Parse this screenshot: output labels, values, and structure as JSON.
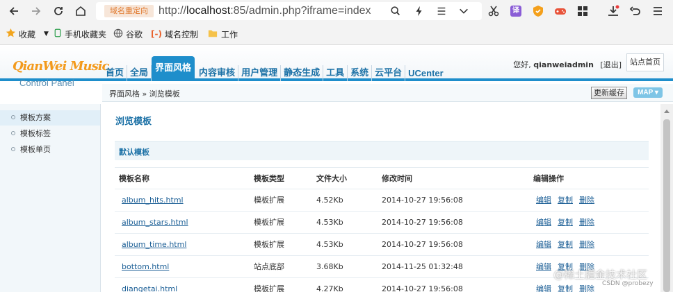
{
  "browser": {
    "redirect_badge": "域名重定向",
    "url_prefix": "http://",
    "url_host": "localhost",
    "url_rest": ":85/admin.php?iframe=index",
    "ext_badge": "译",
    "bookmarks": [
      {
        "label": "收藏",
        "icon": "star-icon"
      },
      {
        "label": "手机收藏夹",
        "icon": "phone-icon"
      },
      {
        "label": "谷歌",
        "icon": "globe-icon"
      },
      {
        "label": "域名控制",
        "icon": "bracket-icon"
      },
      {
        "label": "工作",
        "icon": "folder-icon"
      }
    ]
  },
  "header": {
    "logo_main": "QianWei Music",
    "logo_sub": "Control Panel",
    "nav": [
      {
        "label": "首页"
      },
      {
        "label": "全局"
      },
      {
        "label": "界面风格",
        "active": true
      },
      {
        "label": "内容审核"
      },
      {
        "label": "用户管理"
      },
      {
        "label": "静态生成"
      },
      {
        "label": "工具"
      },
      {
        "label": "系统"
      },
      {
        "label": "云平台"
      },
      {
        "label": "UCenter"
      }
    ],
    "greeting": "您好, ",
    "username": "qianweiadmin",
    "logout": "[退出]",
    "site_home": "站点首页"
  },
  "subheader": {
    "breadcrumb": "界面风格 » 浏览模板",
    "refresh_label": "更新缓存",
    "map_label": "MAP ▾"
  },
  "sidebar": {
    "items": [
      {
        "label": "模板方案",
        "active": true
      },
      {
        "label": "模板标签"
      },
      {
        "label": "模板单页"
      }
    ]
  },
  "main": {
    "title": "浏览模板",
    "section_title": "默认模板",
    "columns": [
      "模板名称",
      "模板类型",
      "文件大小",
      "修改时间",
      "编辑操作"
    ],
    "actions": [
      "编辑",
      "复制",
      "删除"
    ],
    "rows": [
      {
        "name": "album_hits.html",
        "type": "模板扩展",
        "size": "4.52Kb",
        "mtime": "2014-10-27 19:56:08"
      },
      {
        "name": "album_stars.html",
        "type": "模板扩展",
        "size": "4.53Kb",
        "mtime": "2014-10-27 19:56:08"
      },
      {
        "name": "album_time.html",
        "type": "模板扩展",
        "size": "4.53Kb",
        "mtime": "2014-10-27 19:56:08"
      },
      {
        "name": "bottom.html",
        "type": "站点底部",
        "size": "3.68Kb",
        "mtime": "2014-11-25 01:32:48"
      },
      {
        "name": "diangetai.html",
        "type": "模板扩展",
        "size": "4.27Kb",
        "mtime": "2014-10-27 19:56:08"
      }
    ]
  },
  "watermark": {
    "main": "@稀土掘金技术社区",
    "sub": "CSDN @probezy"
  },
  "colors": {
    "accent": "#1e8ecb",
    "logo": "#f39a1c",
    "link": "#1c5f96"
  }
}
